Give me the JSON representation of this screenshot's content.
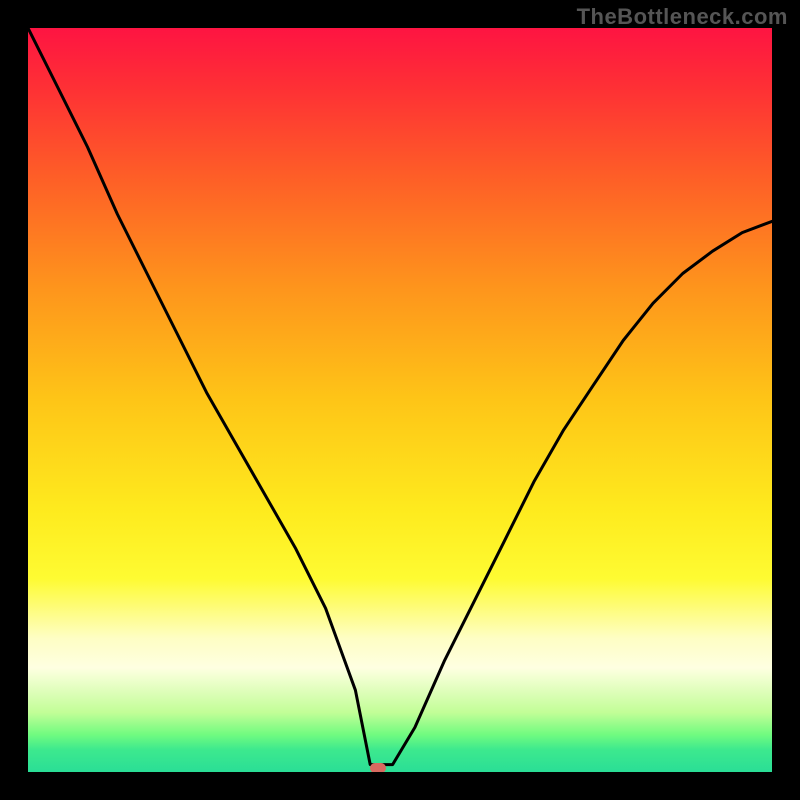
{
  "watermark": "TheBottleneck.com",
  "colors": {
    "background": "#000000",
    "gradient_stops": [
      {
        "pos": 0.0,
        "hex": "#fe1442"
      },
      {
        "pos": 0.08,
        "hex": "#fe3035"
      },
      {
        "pos": 0.2,
        "hex": "#fe5e27"
      },
      {
        "pos": 0.35,
        "hex": "#fe951c"
      },
      {
        "pos": 0.5,
        "hex": "#fec517"
      },
      {
        "pos": 0.65,
        "hex": "#feeb1e"
      },
      {
        "pos": 0.74,
        "hex": "#fefb32"
      },
      {
        "pos": 0.82,
        "hex": "#fefec4"
      },
      {
        "pos": 0.86,
        "hex": "#feffe1"
      },
      {
        "pos": 0.92,
        "hex": "#c2fe97"
      },
      {
        "pos": 0.95,
        "hex": "#70fb80"
      },
      {
        "pos": 0.97,
        "hex": "#3de98e"
      },
      {
        "pos": 1.0,
        "hex": "#2ade96"
      }
    ],
    "curve_stroke": "#000000",
    "marker_fill": "#d86a60"
  },
  "marker": {
    "x_pct": 47.0,
    "y_pct": 99.5
  },
  "chart_data": {
    "type": "line",
    "title": "",
    "xlabel": "",
    "ylabel": "",
    "xlim": [
      0,
      100
    ],
    "ylim": [
      0,
      100
    ],
    "note": "x and y are percentage of plot width/height; origin bottom-left. V-shaped curve; background heatmap decreases from top (red) to bottom (green); marker at curve minimum.",
    "series": [
      {
        "name": "curve",
        "x": [
          0,
          4,
          8,
          12,
          16,
          20,
          24,
          28,
          32,
          36,
          40,
          44,
          46,
          49,
          52,
          56,
          60,
          64,
          68,
          72,
          76,
          80,
          84,
          88,
          92,
          96,
          100
        ],
        "y": [
          100,
          92,
          84,
          75,
          67,
          59,
          51,
          44,
          37,
          30,
          22,
          11,
          1,
          1,
          6,
          15,
          23,
          31,
          39,
          46,
          52,
          58,
          63,
          67,
          70,
          72.5,
          74
        ]
      }
    ],
    "flat_segment": {
      "x_start": 44,
      "x_end": 49,
      "y": 0.5
    },
    "marker_point": {
      "x": 47.0,
      "y": 0.5
    }
  }
}
